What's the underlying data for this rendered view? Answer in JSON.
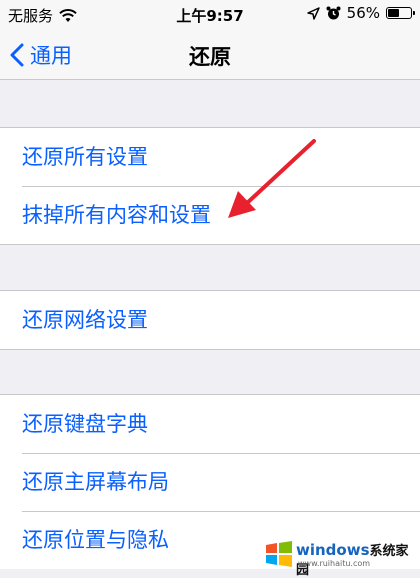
{
  "status": {
    "carrier": "无服务",
    "time": "上午9:57",
    "battery": "56%",
    "battery_level": 0.56
  },
  "nav": {
    "back_label": "通用",
    "title": "还原"
  },
  "groups": [
    {
      "items": [
        "还原所有设置",
        "抹掉所有内容和设置"
      ]
    },
    {
      "items": [
        "还原网络设置"
      ]
    },
    {
      "items": [
        "还原键盘字典",
        "还原主屏幕布局",
        "还原位置与隐私"
      ]
    }
  ],
  "watermark": {
    "brand": "windows",
    "brand_cn": "系统家园",
    "url": "www.ruihaitu.com"
  },
  "colors": {
    "accent": "#0a60ff",
    "annotation_arrow": "#e8212e"
  }
}
